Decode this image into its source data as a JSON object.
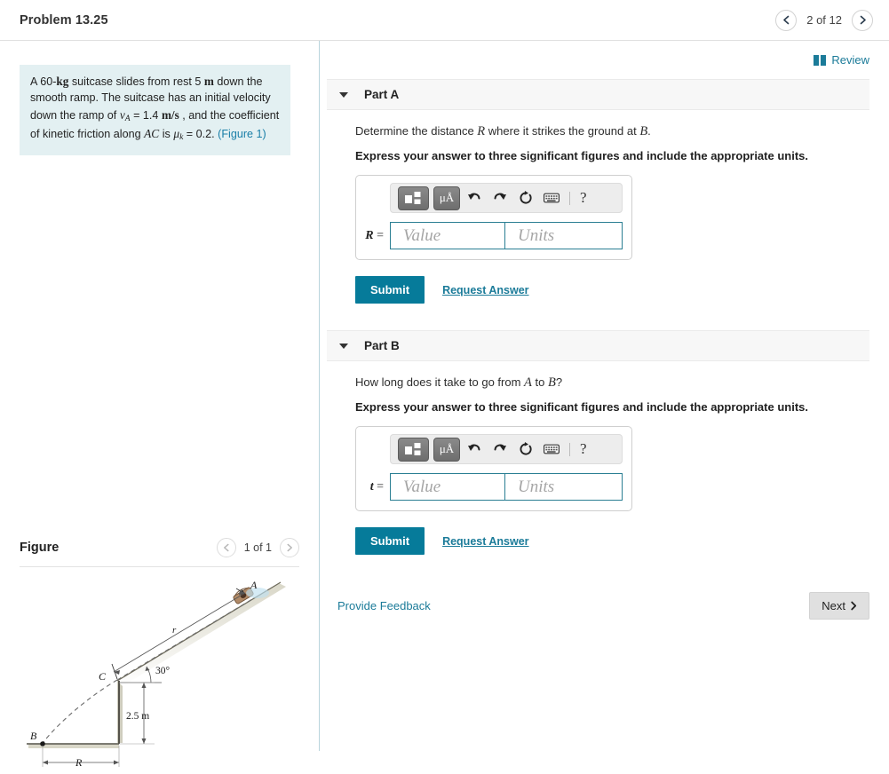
{
  "header": {
    "title": "Problem 13.25",
    "pagination": {
      "prev_icon": "chevron-left-icon",
      "label": "2 of 12",
      "next_icon": "chevron-right-icon"
    }
  },
  "problem_statement": {
    "line1_a": "A 60-",
    "line1_kg": "kg",
    "line1_b": " suitcase slides from rest 5 ",
    "line1_m": "m",
    "line1_c": " down the smooth ramp. The suitcase has an initial velocity down the ramp of ",
    "v_symbol": "v",
    "v_sub": "A",
    "eq1": " = 1.4 ",
    "units_ms": "m/s",
    "mid": " , and the coefficient of kinetic friction along ",
    "ac": "AC",
    "is_text": " is ",
    "mu_symbol": "μ",
    "mu_sub": "k",
    "eq2": " = 0.2. ",
    "figure_link": "(Figure 1)"
  },
  "figure": {
    "title": "Figure",
    "pagination": {
      "prev_icon": "chevron-left-icon",
      "label": "1 of 1",
      "next_icon": "chevron-right-icon"
    },
    "labels": {
      "point_a": "A",
      "point_b": "B",
      "point_c": "C",
      "ramp_length": "r",
      "angle": "30°",
      "height": "2.5 m",
      "range": "R"
    }
  },
  "review": {
    "icon": "book-icon",
    "label": "Review"
  },
  "parts": [
    {
      "id": "part-a",
      "label": "Part A",
      "caret_icon": "caret-down-icon",
      "question_pre": "Determine the distance ",
      "question_var": "R",
      "question_mid": " where it strikes the ground at ",
      "question_var2": "B",
      "question_post": ".",
      "instruction": "Express your answer to three significant figures and include the appropriate units.",
      "toolbar": {
        "template_icon": "math-template-icon",
        "units_icon": "units-mu-angstrom-icon",
        "units_text": "μÅ",
        "undo_icon": "undo-arrow-icon",
        "redo_icon": "redo-arrow-icon",
        "reset_icon": "reset-circle-icon",
        "keyboard_icon": "keyboard-icon",
        "help_label": "?"
      },
      "variable": "R",
      "equals": "=",
      "value_placeholder": "Value",
      "units_placeholder": "Units",
      "value": "",
      "units": "",
      "submit_label": "Submit",
      "request_label": "Request Answer"
    },
    {
      "id": "part-b",
      "label": "Part B",
      "caret_icon": "caret-down-icon",
      "question_pre": "How long does it take to go from ",
      "question_var": "A",
      "question_mid": " to ",
      "question_var2": "B",
      "question_post": "?",
      "instruction": "Express your answer to three significant figures and include the appropriate units.",
      "toolbar": {
        "template_icon": "math-template-icon",
        "units_icon": "units-mu-angstrom-icon",
        "units_text": "μÅ",
        "undo_icon": "undo-arrow-icon",
        "redo_icon": "redo-arrow-icon",
        "reset_icon": "reset-circle-icon",
        "keyboard_icon": "keyboard-icon",
        "help_label": "?"
      },
      "variable": "t",
      "equals": "=",
      "value_placeholder": "Value",
      "units_placeholder": "Units",
      "value": "",
      "units": "",
      "submit_label": "Submit",
      "request_label": "Request Answer"
    }
  ],
  "footer": {
    "feedback_label": "Provide Feedback",
    "next_label": "Next",
    "next_icon": "chevron-right-icon"
  },
  "colors": {
    "accent_teal": "#1b7b99",
    "submit_blue": "#067b9a",
    "statement_bg": "#e3f0f2",
    "input_border": "#2b7f93",
    "divider": "#b9d4dc"
  }
}
